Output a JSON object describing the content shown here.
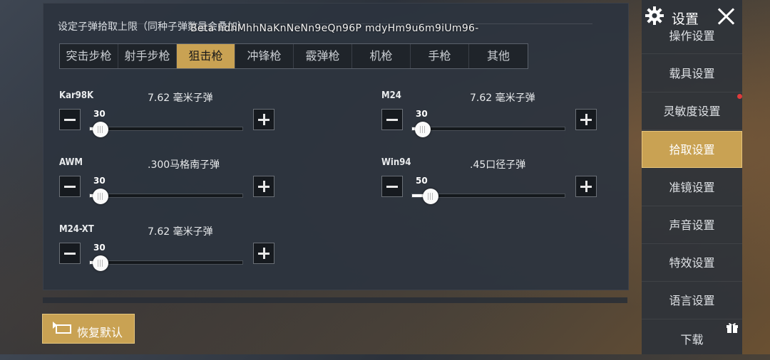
{
  "panel": {
    "title": "设定子弹拾取上限（同种子弹数量会叠加）",
    "watermark": "Beta hdhMhhNaKnNeNn9eQn96P mdyHm9u6m9iUm96-"
  },
  "tabs": [
    {
      "label": "突击步枪",
      "active": false
    },
    {
      "label": "射手步枪",
      "active": false
    },
    {
      "label": "狙击枪",
      "active": true
    },
    {
      "label": "冲锋枪",
      "active": false
    },
    {
      "label": "霰弹枪",
      "active": false
    },
    {
      "label": "机枪",
      "active": false
    },
    {
      "label": "手枪",
      "active": false
    },
    {
      "label": "其他",
      "active": false
    }
  ],
  "guns": [
    {
      "name": "Kar98K",
      "ammo": "7.62 毫米子弹",
      "value": "30",
      "fraction": 0.07
    },
    {
      "name": "M24",
      "ammo": "7.62 毫米子弹",
      "value": "30",
      "fraction": 0.07
    },
    {
      "name": "AWM",
      "ammo": ".300马格南子弹",
      "value": "30",
      "fraction": 0.07
    },
    {
      "name": "Win94",
      "ammo": ".45口径子弹",
      "value": "50",
      "fraction": 0.12
    },
    {
      "name": "M24-XT",
      "ammo": "7.62 毫米子弹",
      "value": "30",
      "fraction": 0.07
    }
  ],
  "reset_button": {
    "label": "恢复默认"
  },
  "sidebar": {
    "title": "设置",
    "items": [
      {
        "label": "操作设置",
        "active": false
      },
      {
        "label": "载具设置",
        "active": false
      },
      {
        "label": "灵敏度设置",
        "active": false
      },
      {
        "label": "拾取设置",
        "active": true
      },
      {
        "label": "准镜设置",
        "active": false
      },
      {
        "label": "声音设置",
        "active": false
      },
      {
        "label": "特效设置",
        "active": false
      },
      {
        "label": "语言设置",
        "active": false
      },
      {
        "label": "下载",
        "active": false
      }
    ]
  },
  "colors": {
    "accent": "#c9a253",
    "notification": "#e03b3b"
  }
}
